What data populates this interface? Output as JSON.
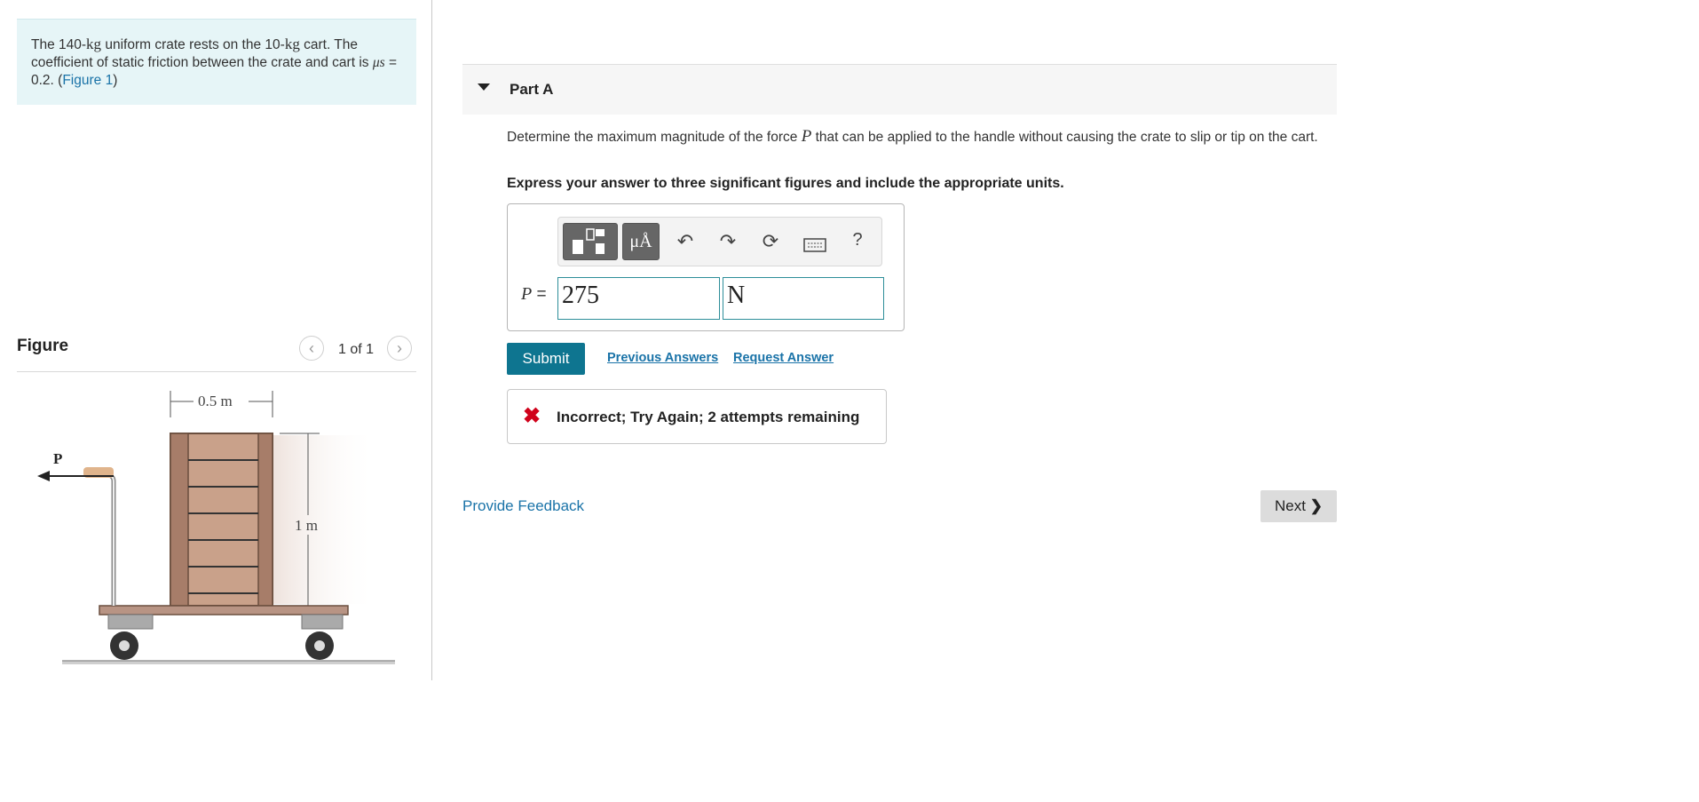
{
  "problem": {
    "part1": "The 140-",
    "kg1": "kg",
    "part2": " uniform crate rests on the 10-",
    "kg2": "kg",
    "part3": " cart. The coefficient of static friction between the crate and cart is ",
    "mu": "μs",
    "part4": " = 0.2. (",
    "figure_link": "Figure 1",
    "part5": ")"
  },
  "figure": {
    "title": "Figure",
    "count": "1 of 1",
    "prev_icon": "chevron-left-icon",
    "next_icon": "chevron-right-icon",
    "label_width": "0.5 m",
    "label_height": "1 m",
    "label_force": "P"
  },
  "part": {
    "title": "Part A",
    "question_before": "Determine the maximum magnitude of the force ",
    "question_var": "P",
    "question_after": " that can be applied to the handle without causing the crate to slip or tip on the cart.",
    "instruction": "Express your answer to three significant figures and include the appropriate units."
  },
  "toolbar": {
    "units_symbol": "μÅ",
    "help": "?",
    "icons": [
      "templates-icon",
      "units-icon",
      "undo-icon",
      "redo-icon",
      "reset-icon",
      "keyboard-icon",
      "help-icon"
    ]
  },
  "answer": {
    "label_var": "P",
    "label_eq": " =",
    "value": "275",
    "unit": "N"
  },
  "actions": {
    "submit": "Submit",
    "previous_answers": "Previous Answers",
    "request_answer": "Request Answer"
  },
  "feedback": {
    "icon": "x-icon",
    "message": "Incorrect; Try Again; 2 attempts remaining"
  },
  "footer": {
    "provide_feedback": "Provide Feedback",
    "next": "Next"
  },
  "colors": {
    "problem_bg": "#e6f5f7",
    "link": "#1a73a8",
    "submit_bg": "#0e7590",
    "error": "#d0021b",
    "input_border": "#2d8e99"
  }
}
